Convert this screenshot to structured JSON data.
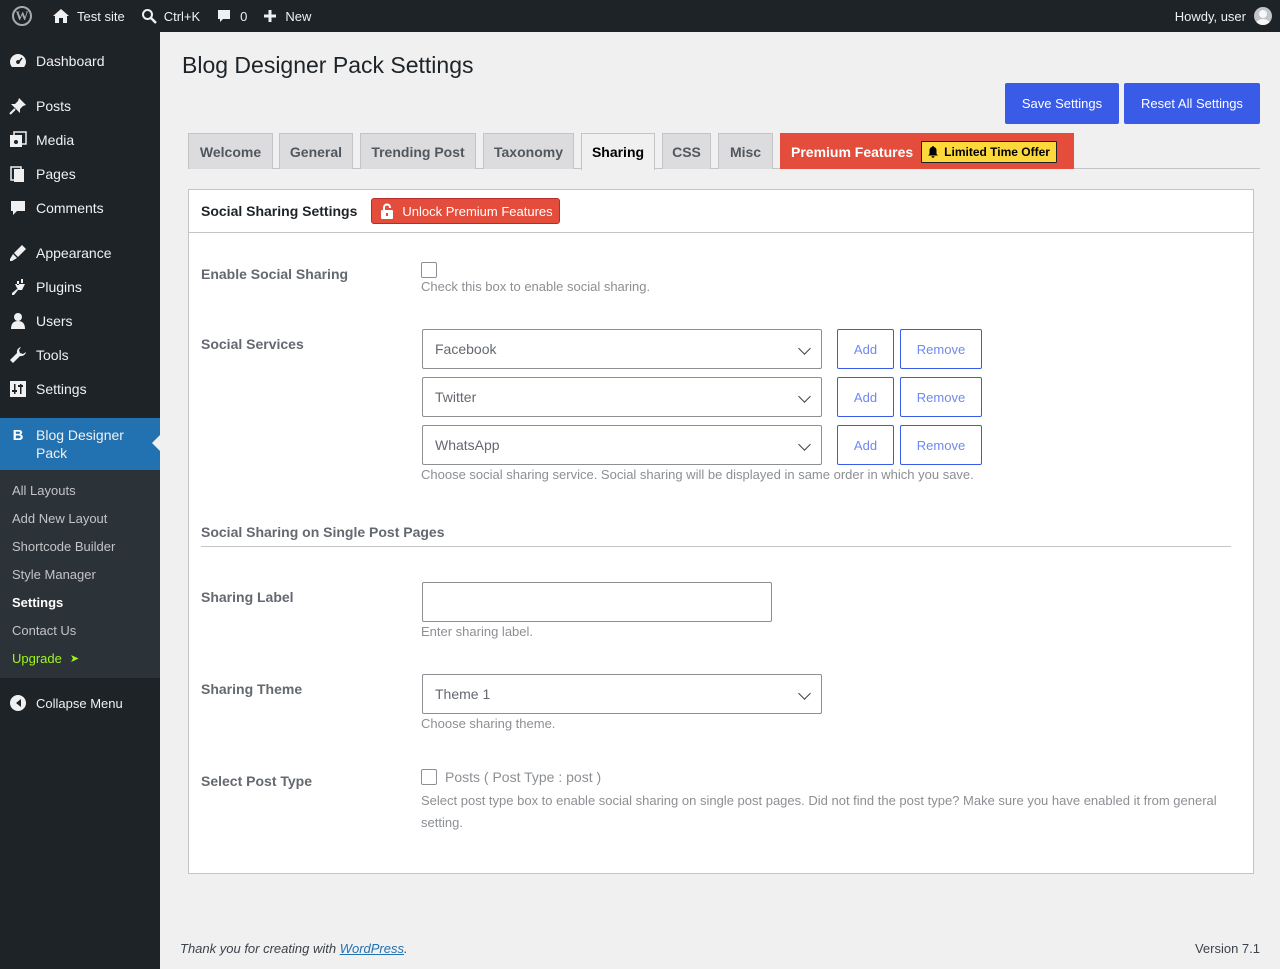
{
  "adminbar": {
    "site_name": "Test site",
    "search_shortcut": "Ctrl+K",
    "comments_count": "0",
    "new_label": "New",
    "howdy": "Howdy, user"
  },
  "sidebar": {
    "items": [
      {
        "label": "Dashboard",
        "icon": "dashboard-icon"
      },
      {
        "label": "Posts",
        "icon": "pushpin-icon"
      },
      {
        "label": "Media",
        "icon": "media-icon"
      },
      {
        "label": "Pages",
        "icon": "pages-icon"
      },
      {
        "label": "Comments",
        "icon": "comment-icon"
      },
      {
        "label": "Appearance",
        "icon": "brush-icon"
      },
      {
        "label": "Plugins",
        "icon": "plugin-icon"
      },
      {
        "label": "Users",
        "icon": "user-icon"
      },
      {
        "label": "Tools",
        "icon": "wrench-icon"
      },
      {
        "label": "Settings",
        "icon": "sliders-icon"
      }
    ],
    "current": {
      "label": "Blog Designer Pack",
      "icon_letter": "B"
    },
    "submenu": [
      "All Layouts",
      "Add New Layout",
      "Shortcode Builder",
      "Style Manager",
      "Settings",
      "Contact Us",
      "Upgrade"
    ],
    "upgrade_arrow": "➤",
    "collapse_label": "Collapse Menu"
  },
  "page": {
    "title": "Blog Designer Pack Settings",
    "save_button": "Save Settings",
    "reset_button": "Reset All Settings"
  },
  "tabs": [
    "Welcome",
    "General",
    "Trending Post",
    "Taxonomy",
    "Sharing",
    "CSS",
    "Misc",
    "Premium Features"
  ],
  "active_tab": "Sharing",
  "limited_offer": "Limited Time Offer",
  "panel": {
    "title": "Social Sharing Settings",
    "unlock_label": "Unlock Premium Features",
    "enable_label": "Enable Social Sharing",
    "enable_desc": "Check this box to enable social sharing.",
    "services_label": "Social Services",
    "services": [
      "Facebook",
      "Twitter",
      "WhatsApp"
    ],
    "add_label": "Add",
    "remove_label": "Remove",
    "services_desc": "Choose social sharing service. Social sharing will be displayed in same order in which you save.",
    "single_section": "Social Sharing on Single Post Pages",
    "sharing_label_label": "Sharing Label",
    "sharing_label_value": "",
    "sharing_label_desc": "Enter sharing label.",
    "theme_label": "Sharing Theme",
    "theme_value": "Theme 1",
    "theme_desc": "Choose sharing theme.",
    "post_type_label": "Select Post Type",
    "post_type_option": "Posts ( Post Type : post )",
    "post_type_desc": "Select post type box to enable social sharing on single post pages. Did not find the post type? Make sure you have enabled it from general setting."
  },
  "footer": {
    "thanks_prefix": "Thank you for creating with ",
    "thanks_link": "WordPress",
    "thanks_suffix": ".",
    "version": "Version 7.1"
  },
  "colors": {
    "adminbar_bg": "#1d2327",
    "primary_button": "#3a5ae8",
    "premium_tab": "#e44d3c",
    "offer_badge": "#fdd83a",
    "upgrade_link": "#9ff51a"
  }
}
